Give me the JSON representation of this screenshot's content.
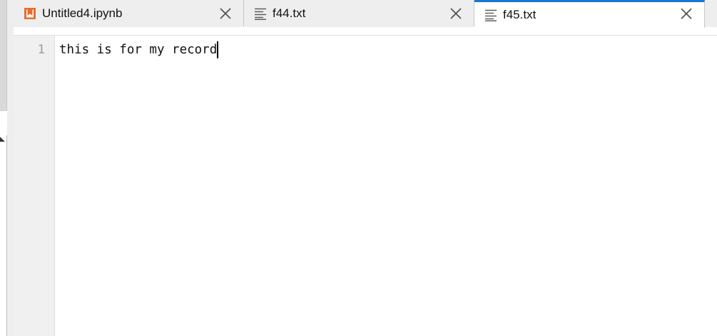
{
  "tabs": [
    {
      "label": "Untitled4.ipynb",
      "icon": "notebook-icon",
      "active": false
    },
    {
      "label": "f44.txt",
      "icon": "text-file-icon",
      "active": false
    },
    {
      "label": "f45.txt",
      "icon": "text-file-icon",
      "active": true
    }
  ],
  "editor": {
    "line_numbers": [
      "1"
    ],
    "lines": [
      "this is for my record"
    ]
  },
  "colors": {
    "active_tab_accent": "#1976d2",
    "notebook_icon": "#e46e2e",
    "tab_bg": "#eeeeee"
  }
}
